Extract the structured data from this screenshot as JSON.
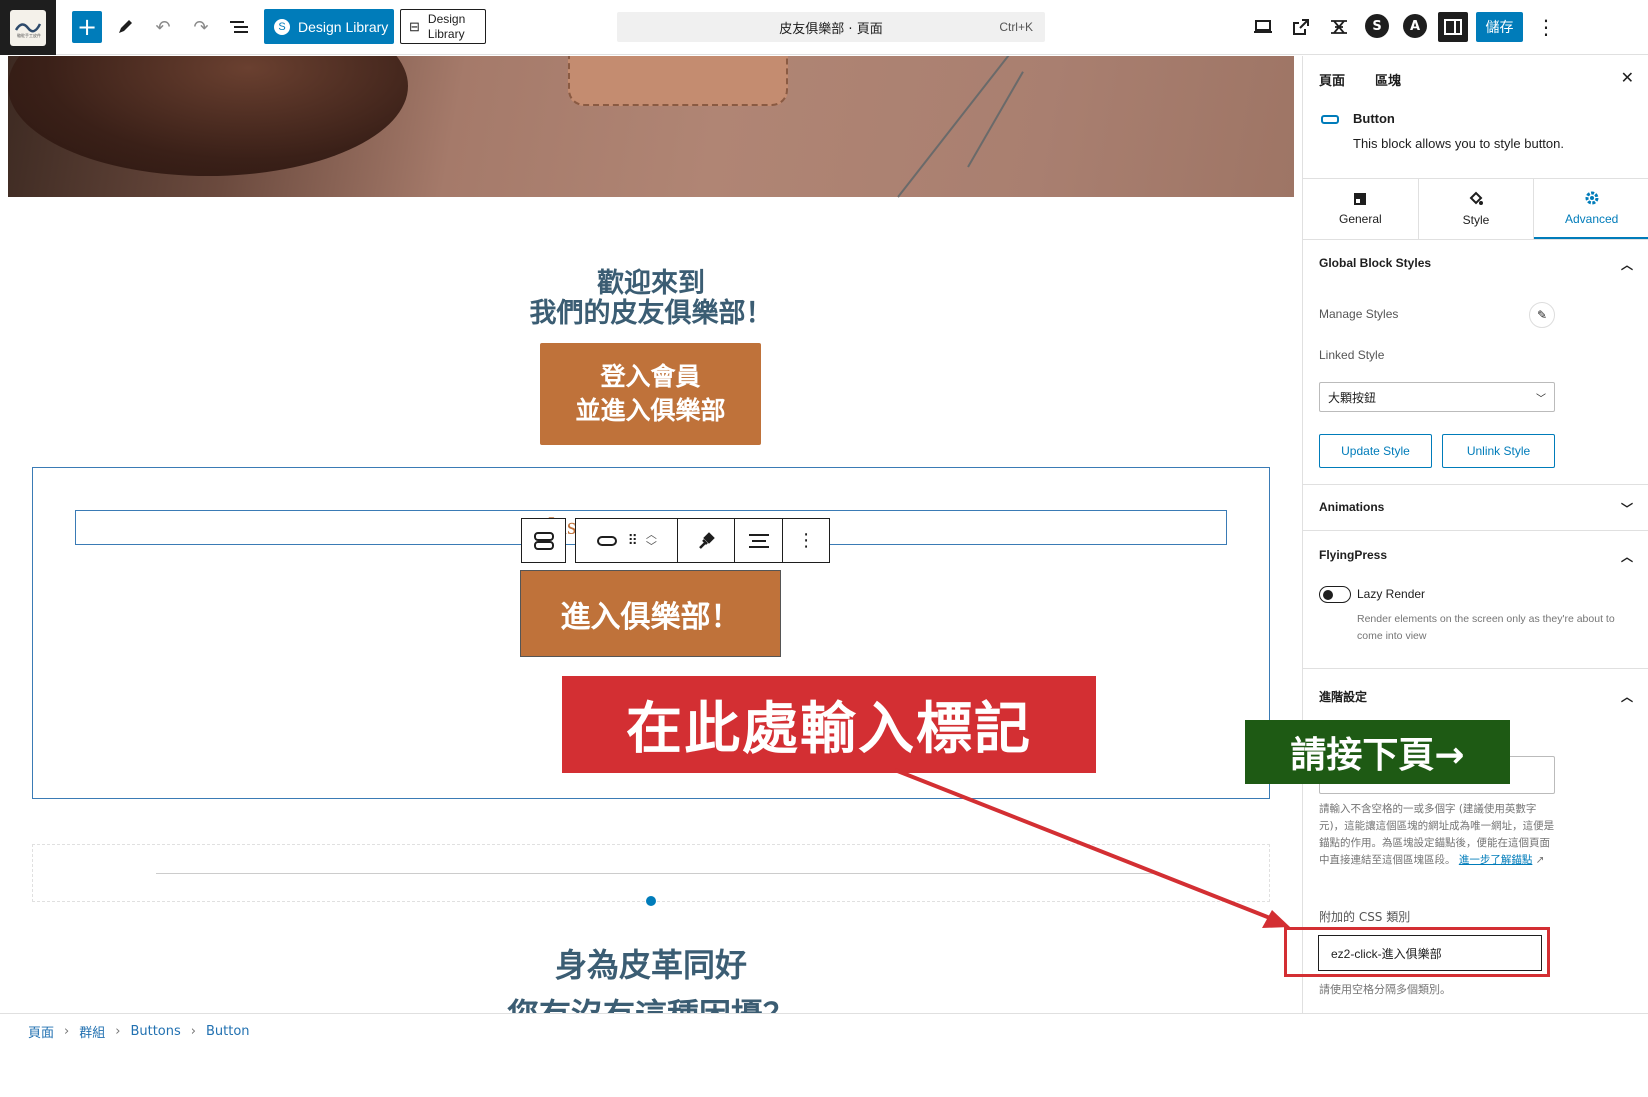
{
  "topbar": {
    "design_library_label": "Design Library",
    "design_library_secondary": "Design\nLibrary",
    "command_title": "皮友俱樂部 · 頁面",
    "command_shortcut": "Ctrl+K",
    "save_label": "儲存"
  },
  "canvas": {
    "welcome_line1": "歡迎來到",
    "welcome_line2": "我們的皮友俱樂部！",
    "login_button_line1": "登入會員",
    "login_button_line2": "並進入俱樂部",
    "shortcode_text": "[user",
    "shortcode_text_2": "r",
    "enter_button": "進入俱樂部！",
    "heading2_line1": "身為皮革同好",
    "heading2_line2": "您有沒有這種困擾？"
  },
  "annotations": {
    "red_banner": "在此處輸入標記",
    "green_banner": "請接下頁→"
  },
  "sidebar": {
    "tab_page": "頁面",
    "tab_block": "區塊",
    "block_title": "Button",
    "block_desc": "This block allows you to style button.",
    "panel_tabs": [
      "General",
      "Style",
      "Advanced"
    ],
    "global_styles_title": "Global Block Styles",
    "manage_styles": "Manage Styles",
    "linked_style": "Linked Style",
    "linked_style_value": "大顆按鈕",
    "update_style": "Update Style",
    "unlink_style": "Unlink Style",
    "animations": "Animations",
    "flyingpress": "FlyingPress",
    "lazy_render": "Lazy Render",
    "lazy_render_help": "Render elements on the screen only as they're about to come into view",
    "advanced_title": "進階設定",
    "anchor_help": "請輸入不含空格的一或多個字 (建議使用英數字元)，這能讓這個區塊的網址成為唯一網址，這便是錨點的作用。為區塊設定錨點後，便能在這個頁面中直接連結至這個區塊區段。",
    "anchor_link": "進一步了解錨點",
    "css_label": "附加的 CSS 類別",
    "css_value": "ez2-click-進入俱樂部",
    "css_help": "請使用空格分隔多個類別。"
  },
  "breadcrumb": [
    "頁面",
    "群組",
    "Buttons",
    "Button"
  ],
  "colors": {
    "accent": "#007cba",
    "brand_orange": "#bf723a",
    "heading_blue": "#3b5d73",
    "annotation_red": "#d32f33",
    "annotation_green": "#1e5a14"
  }
}
